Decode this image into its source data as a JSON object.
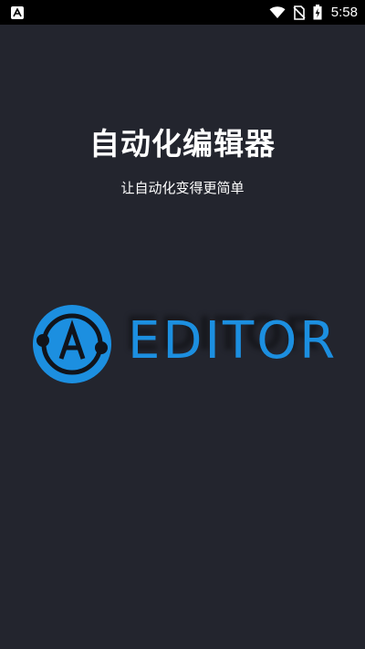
{
  "status_bar": {
    "time": "5:58",
    "icons": [
      "app-notification-icon",
      "wifi-icon",
      "no-sim-icon",
      "battery-charging-icon"
    ]
  },
  "splash": {
    "title": "自动化编辑器",
    "subtitle": "让自动化变得更简单",
    "logo_letter": "A",
    "logo_text": "EDITOR"
  },
  "colors": {
    "background": "#23252e",
    "accent_blue": "#1c8fe0",
    "status_bar": "#000000"
  }
}
